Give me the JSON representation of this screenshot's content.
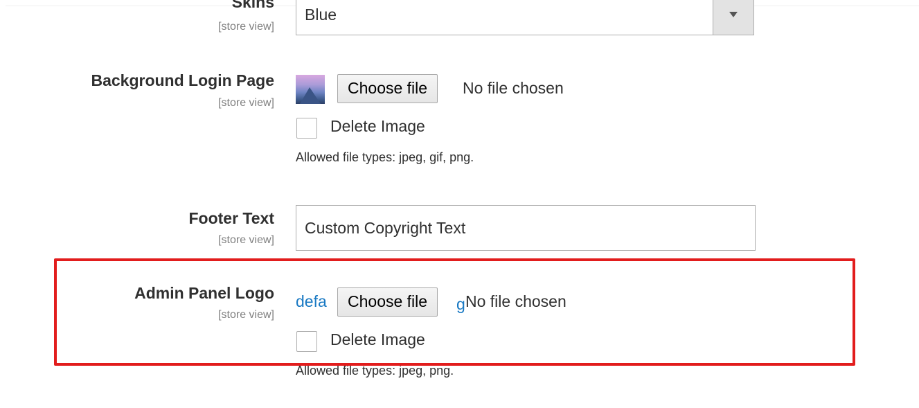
{
  "skins": {
    "label": "Skins",
    "scope": "[store view]",
    "selected": "Blue"
  },
  "background_login": {
    "label": "Background Login Page",
    "scope": "[store view]",
    "choose_file_label": "Choose file",
    "file_status": "No file chosen",
    "delete_label": "Delete Image",
    "note": "Allowed file types: jpeg, gif, png."
  },
  "footer_text": {
    "label": "Footer Text",
    "scope": "[store view]",
    "value": "Custom Copyright Text"
  },
  "admin_logo": {
    "label": "Admin Panel Logo",
    "scope": "[store view]",
    "link_prefix": "defa",
    "link_suffix": "g",
    "choose_file_label": "Choose file",
    "file_status": "No file chosen",
    "delete_label": "Delete Image",
    "note": "Allowed file types: jpeg, png."
  },
  "colors": {
    "highlight": "#e21d1d",
    "link": "#1979c3",
    "scope_text": "#808080"
  },
  "icons": {
    "select_arrow": "chevron-down-icon",
    "thumbnail": "image-thumbnail"
  }
}
